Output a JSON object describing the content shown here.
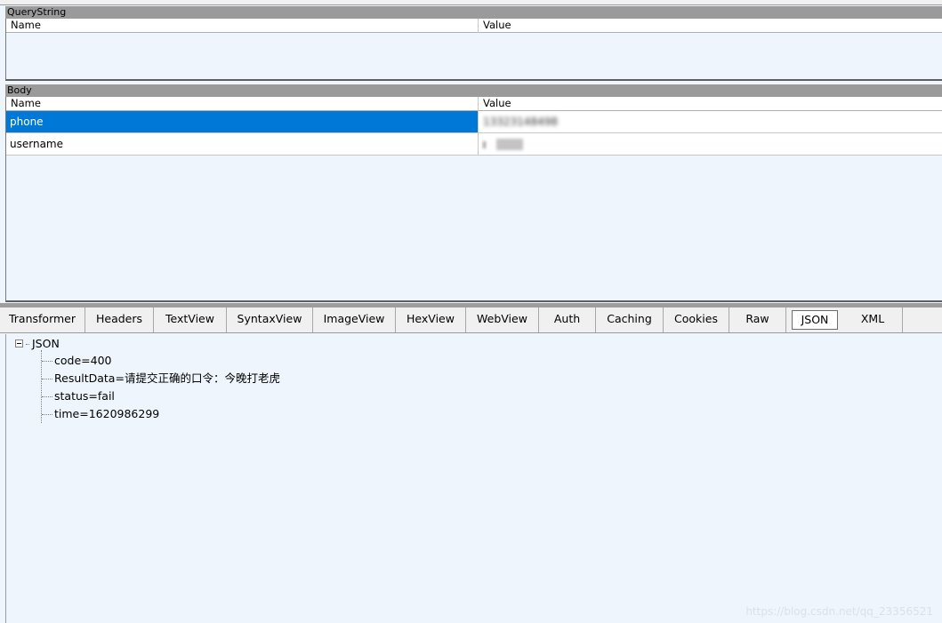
{
  "query_string": {
    "title": "QueryString",
    "columns": {
      "name": "Name",
      "value": "Value"
    },
    "rows": []
  },
  "body": {
    "title": "Body",
    "columns": {
      "name": "Name",
      "value": "Value"
    },
    "rows": [
      {
        "name": "phone",
        "value": "13323148498"
      },
      {
        "name": "username",
        "value": ""
      }
    ]
  },
  "tabs": [
    {
      "label": "Transformer"
    },
    {
      "label": "Headers"
    },
    {
      "label": "TextView"
    },
    {
      "label": "SyntaxView"
    },
    {
      "label": "ImageView"
    },
    {
      "label": "HexView"
    },
    {
      "label": "WebView"
    },
    {
      "label": "Auth"
    },
    {
      "label": "Caching"
    },
    {
      "label": "Cookies"
    },
    {
      "label": "Raw"
    },
    {
      "label": "JSON",
      "active": true
    },
    {
      "label": "XML"
    }
  ],
  "json_tree": {
    "root_label": "JSON",
    "items": [
      {
        "text": "code=400"
      },
      {
        "text": "ResultData=请提交正确的口令：今晚打老虎"
      },
      {
        "text": "status=fail"
      },
      {
        "text": "time=1620986299"
      }
    ]
  },
  "watermark": "https://blog.csdn.net/qq_23356521",
  "colors": {
    "selection": "#0078d7",
    "panel_bg": "#eef5fc",
    "header_bar": "#9a9a9a"
  },
  "icons": {
    "tree_toggle": "collapse-minus-icon"
  }
}
